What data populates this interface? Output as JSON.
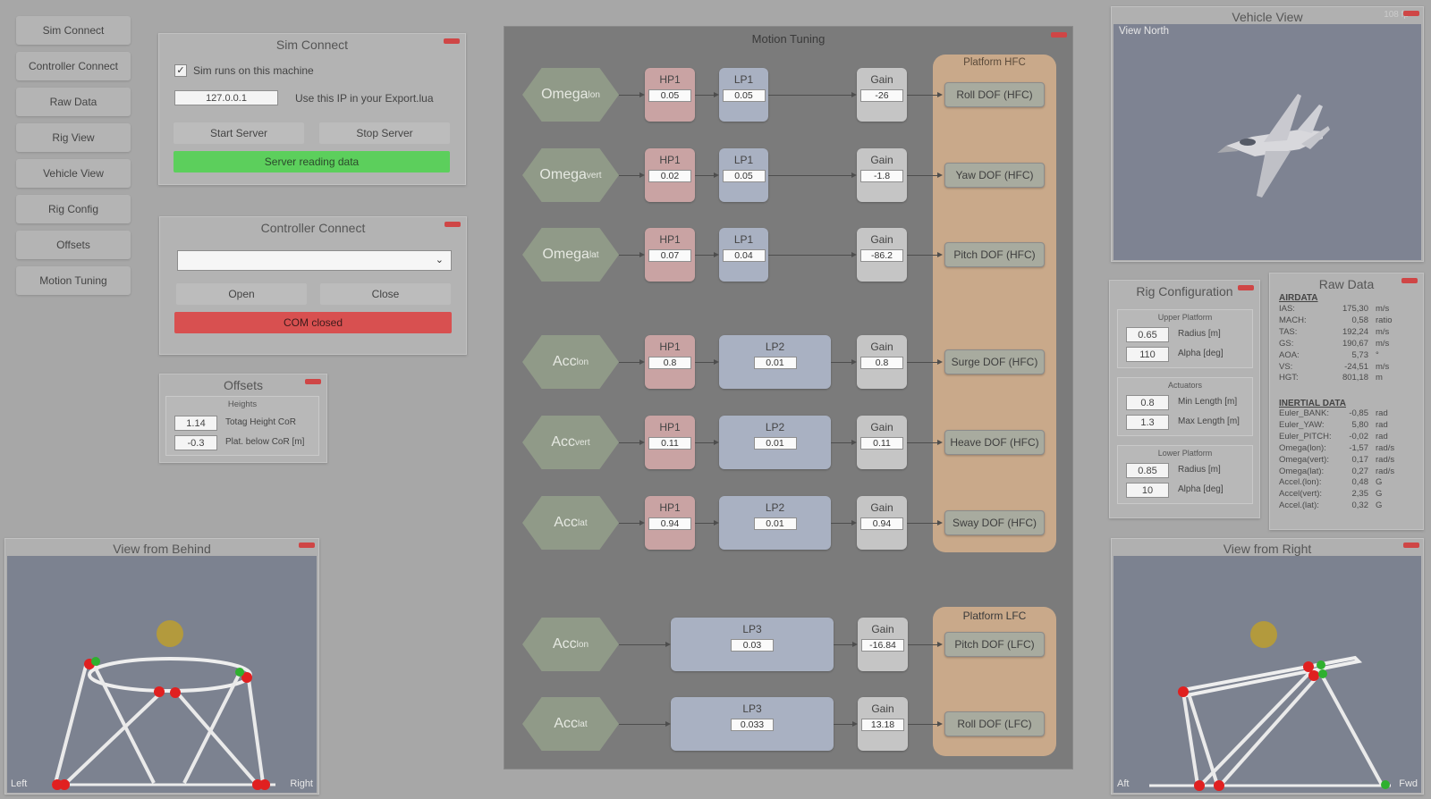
{
  "nav": [
    "Sim Connect",
    "Controller Connect",
    "Raw Data",
    "Rig View",
    "Vehicle View",
    "Rig Config",
    "Offsets",
    "Motion Tuning"
  ],
  "sim_connect": {
    "title": "Sim Connect",
    "checkbox_label": "Sim runs on this machine",
    "ip": "127.0.0.1",
    "ip_hint": "Use this IP in your Export.lua",
    "start": "Start Server",
    "stop": "Stop Server",
    "status": "Server reading data",
    "status_color": "#5ccf5c"
  },
  "controller_connect": {
    "title": "Controller Connect",
    "open": "Open",
    "close": "Close",
    "status": "COM closed",
    "status_color": "#d85050"
  },
  "offsets": {
    "title": "Offsets",
    "group": "Heights",
    "rows": [
      {
        "value": "1.14",
        "label": "Totag Height CoR"
      },
      {
        "value": "-0.3",
        "label": "Plat. below CoR [m]"
      }
    ]
  },
  "motion_tuning": {
    "title": "Motion Tuning",
    "hfc_title": "Platform HFC",
    "lfc_title": "Platform LFC",
    "hp_label": "HP1",
    "lp1_label": "LP1",
    "lp2_label": "LP2",
    "lp3_label": "LP3",
    "gain_label": "Gain",
    "hfc_rows": [
      {
        "input": "Omega",
        "sub": "lon",
        "hp": "0.05",
        "lp": "0.05",
        "gain": "-26",
        "dof": "Roll DOF (HFC)"
      },
      {
        "input": "Omega",
        "sub": "vert",
        "hp": "0.02",
        "lp": "0.05",
        "gain": "-1.8",
        "dof": "Yaw DOF (HFC)"
      },
      {
        "input": "Omega",
        "sub": "lat",
        "hp": "0.07",
        "lp": "0.04",
        "gain": "-86.2",
        "dof": "Pitch DOF (HFC)"
      },
      {
        "input": "Acc",
        "sub": "lon",
        "hp": "0.8",
        "lp": "0.01",
        "gain": "0.8",
        "dof": "Surge DOF (HFC)"
      },
      {
        "input": "Acc",
        "sub": "vert",
        "hp": "0.11",
        "lp": "0.01",
        "gain": "0.11",
        "dof": "Heave DOF (HFC)"
      },
      {
        "input": "Acc",
        "sub": "lat",
        "hp": "0.94",
        "lp": "0.01",
        "gain": "0.94",
        "dof": "Sway DOF (HFC)"
      }
    ],
    "lfc_rows": [
      {
        "input": "Acc",
        "sub": "lon",
        "lp": "0.03",
        "gain": "-16.84",
        "dof": "Pitch DOF (LFC)"
      },
      {
        "input": "Acc",
        "sub": "lat",
        "lp": "0.033",
        "gain": "13.18",
        "dof": "Roll DOF (LFC)"
      }
    ]
  },
  "vehicle_view": {
    "title": "Vehicle View",
    "fps": "108 fp",
    "caption": "View North"
  },
  "rig_config": {
    "title": "Rig Configuration",
    "groups": [
      {
        "title": "Upper Platform",
        "rows": [
          {
            "value": "0.65",
            "label": "Radius [m]"
          },
          {
            "value": "110",
            "label": "Alpha [deg]"
          }
        ]
      },
      {
        "title": "Actuators",
        "rows": [
          {
            "value": "0.8",
            "label": "Min Length [m]"
          },
          {
            "value": "1.3",
            "label": "Max Length [m]"
          }
        ]
      },
      {
        "title": "Lower Platform",
        "rows": [
          {
            "value": "0.85",
            "label": "Radius [m]"
          },
          {
            "value": "10",
            "label": "Alpha [deg]"
          }
        ]
      }
    ]
  },
  "raw_data": {
    "title": "Raw Data",
    "airdata_title": "AIRDATA",
    "airdata": [
      {
        "name": "IAS:",
        "value": "175,30",
        "unit": "m/s"
      },
      {
        "name": "MACH:",
        "value": "0,58",
        "unit": "ratio"
      },
      {
        "name": "TAS:",
        "value": "192,24",
        "unit": "m/s"
      },
      {
        "name": "GS:",
        "value": "190,67",
        "unit": "m/s"
      },
      {
        "name": "AOA:",
        "value": "5,73",
        "unit": "°"
      },
      {
        "name": "VS:",
        "value": "-24,51",
        "unit": "m/s"
      },
      {
        "name": "HGT:",
        "value": "801,18",
        "unit": "m"
      }
    ],
    "inertial_title": "INERTIAL DATA",
    "inertial": [
      {
        "name": "Euler_BANK:",
        "value": "-0,85",
        "unit": "rad"
      },
      {
        "name": "Euler_YAW:",
        "value": "5,80",
        "unit": "rad"
      },
      {
        "name": "Euler_PITCH:",
        "value": "-0,02",
        "unit": "rad"
      },
      {
        "name": "Omega(lon):",
        "value": "-1,57",
        "unit": "rad/s"
      },
      {
        "name": "Omega(vert):",
        "value": "0,17",
        "unit": "rad/s"
      },
      {
        "name": "Omega(lat):",
        "value": "0,27",
        "unit": "rad/s"
      },
      {
        "name": "Accel.(lon):",
        "value": "0,48",
        "unit": "G"
      },
      {
        "name": "Accel(vert):",
        "value": "2,35",
        "unit": "G"
      },
      {
        "name": "Accel.(lat):",
        "value": "0,32",
        "unit": "G"
      }
    ]
  },
  "view_behind": {
    "title": "View from Behind",
    "left": "Left",
    "right": "Right"
  },
  "view_right": {
    "title": "View from Right",
    "left": "Aft",
    "right": "Fwd"
  }
}
